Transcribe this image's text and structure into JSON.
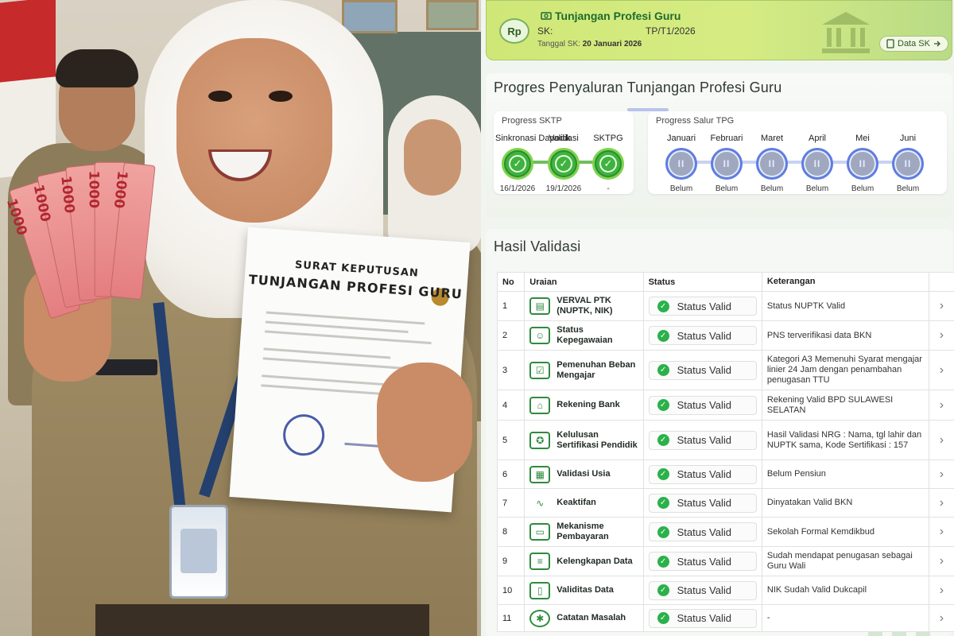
{
  "photo": {
    "document_title_line1": "SURAT KEPUTUSAN",
    "document_title_line2": "TUNJANGAN PROFESI GURU",
    "banknote_label": "1000"
  },
  "sk_card": {
    "badge": "Rp",
    "title": "Tunjangan Profesi Guru",
    "sk_label": "SK:",
    "sk_number": "TP/T1/2026",
    "date_label": "Tanggal SK:",
    "date_value": "20 Januari 2026",
    "data_button": "Data SK",
    "accent_color": "#1f6b2e"
  },
  "progress": {
    "title": "Progres Penyaluran Tunjangan Profesi Guru",
    "sktp": {
      "header": "Progress SKTP",
      "steps": [
        {
          "label": "Sinkronasi Dapodik",
          "date": "16/1/2026",
          "status": "done"
        },
        {
          "label": "Validasi",
          "date": "19/1/2026",
          "status": "done"
        },
        {
          "label": "SKTPG",
          "date": "-",
          "status": "done"
        }
      ]
    },
    "tpg": {
      "header": "Progress Salur TPG",
      "months": [
        {
          "label": "Januari",
          "status": "Belum"
        },
        {
          "label": "Februari",
          "status": "Belum"
        },
        {
          "label": "Maret",
          "status": "Belum"
        },
        {
          "label": "April",
          "status": "Belum"
        },
        {
          "label": "Mei",
          "status": "Belum"
        },
        {
          "label": "Juni",
          "status": "Belum"
        }
      ]
    }
  },
  "validation": {
    "title": "Hasil Validasi",
    "columns": {
      "no": "No",
      "uraian": "Uraian",
      "status": "Status",
      "keterangan": "Keterangan"
    },
    "rows": [
      {
        "no": "1",
        "uraian": "VERVAL PTK (NUPTK, NIK)",
        "icon": "id-card-icon",
        "status": "Status Valid",
        "keterangan": "Status NUPTK Valid"
      },
      {
        "no": "2",
        "uraian": "Status Kepegawaian",
        "icon": "person-badge-icon",
        "status": "Status Valid",
        "keterangan": "PNS terverifikasi data BKN"
      },
      {
        "no": "3",
        "uraian": "Pemenuhan Beban Mengajar",
        "icon": "checklist-icon",
        "status": "Status Valid",
        "keterangan": "Kategori A3 Memenuhi Syarat mengajar linier 24 Jam dengan penambahan penugasan TTU"
      },
      {
        "no": "4",
        "uraian": "Rekening Bank",
        "icon": "bank-icon",
        "status": "Status Valid",
        "keterangan": "Rekening Valid BPD SULAWESI SELATAN"
      },
      {
        "no": "5",
        "uraian": "Kelulusan Sertifikasi Pendidik",
        "icon": "award-icon",
        "status": "Status Valid",
        "keterangan": "Hasil Validasi NRG : Nama, tgl lahir dan NUPTK sama, Kode Sertifikasi : 157"
      },
      {
        "no": "6",
        "uraian": "Validasi Usia",
        "icon": "calendar-icon",
        "status": "Status Valid",
        "keterangan": "Belum Pensiun"
      },
      {
        "no": "7",
        "uraian": "Keaktifan",
        "icon": "activity-icon",
        "status": "Status Valid",
        "keterangan": "Dinyatakan Valid BKN"
      },
      {
        "no": "8",
        "uraian": "Mekanisme Pembayaran",
        "icon": "card-icon",
        "status": "Status Valid",
        "keterangan": "Sekolah Formal Kemdikbud"
      },
      {
        "no": "9",
        "uraian": "Kelengkapan Data",
        "icon": "list-icon",
        "status": "Status Valid",
        "keterangan": "Sudah mendapat penugasan sebagai Guru Wali"
      },
      {
        "no": "10",
        "uraian": "Validitas Data",
        "icon": "document-icon",
        "status": "Status Valid",
        "keterangan": "NIK Sudah Valid Dukcapil"
      },
      {
        "no": "11",
        "uraian": "Catatan Masalah",
        "icon": "bug-icon",
        "status": "Status Valid",
        "keterangan": "-"
      }
    ]
  }
}
